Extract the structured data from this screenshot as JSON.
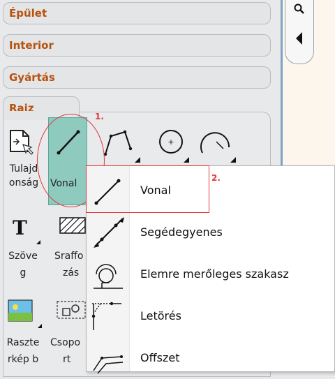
{
  "categories": [
    "Épület",
    "Interior",
    "Gyártás"
  ],
  "active_category": "Rajz",
  "tools": [
    {
      "label_l1": "Tulajd",
      "label_l2": "onság"
    },
    {
      "label_l1": "Vonal",
      "label_l2": ""
    },
    {
      "label_l1": "Szöve",
      "label_l2": "g"
    },
    {
      "label_l1": "Sraffo",
      "label_l2": "zás"
    },
    {
      "label_l1": "Raszte",
      "label_l2": "rkép b"
    },
    {
      "label_l1": "Csopo",
      "label_l2": "rt"
    }
  ],
  "annotations": {
    "step1": "1.",
    "step2": "2."
  },
  "menu": {
    "items": [
      {
        "label": "Vonal",
        "icon": "line-icon"
      },
      {
        "label": "Segédegyenes",
        "icon": "construction-line-icon"
      },
      {
        "label": "Elemre merőleges szakasz",
        "icon": "perpendicular-segment-icon"
      },
      {
        "label": "Letörés",
        "icon": "chamfer-icon"
      },
      {
        "label": "Offszet",
        "icon": "offset-icon"
      }
    ]
  },
  "colors": {
    "category_text": "#b8520f",
    "highlight": "#8fcabe",
    "annotation": "#e03a3a"
  }
}
